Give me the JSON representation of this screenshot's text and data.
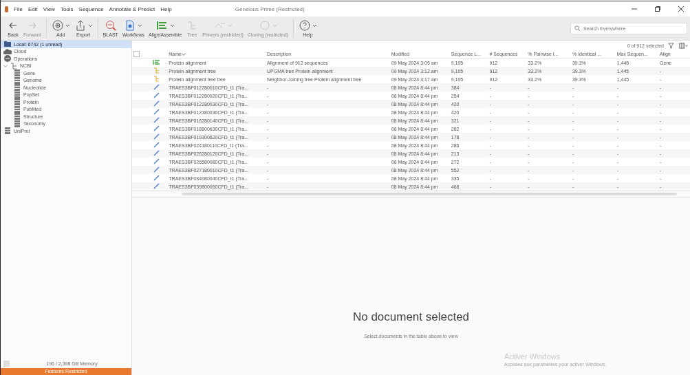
{
  "window": {
    "title": "Geneious Prime (Restricted)"
  },
  "menu": [
    "File",
    "Edit",
    "View",
    "Tools",
    "Sequence",
    "Annotate & Predict",
    "Help"
  ],
  "toolbar": [
    {
      "label": "Back",
      "disabled": false,
      "dropdown": false
    },
    {
      "label": "Forward",
      "disabled": true,
      "dropdown": false
    },
    {
      "label": "Add",
      "disabled": false,
      "dropdown": true
    },
    {
      "label": "Export",
      "disabled": false,
      "dropdown": true
    },
    {
      "label": "BLAST",
      "disabled": false,
      "dropdown": false
    },
    {
      "label": "Workflows",
      "disabled": false,
      "dropdown": true
    },
    {
      "label": "Align/Assemble",
      "disabled": false,
      "dropdown": true
    },
    {
      "label": "Tree",
      "disabled": true,
      "dropdown": false
    },
    {
      "label": "Primers (restricted)",
      "disabled": true,
      "dropdown": true
    },
    {
      "label": "Cloning (restricted)",
      "disabled": true,
      "dropdown": true
    },
    {
      "label": "Help",
      "disabled": false,
      "dropdown": true
    }
  ],
  "search": {
    "placeholder": "Search Everywhere"
  },
  "sidebar": {
    "items": [
      {
        "label": "Local: 6742 (1 unread)",
        "selected": true
      },
      {
        "label": "Cloud",
        "selected": false
      },
      {
        "label": "Operations",
        "selected": false
      },
      {
        "label": "NCBI",
        "selected": false,
        "expanded": true,
        "children": [
          {
            "label": "Gene",
            "selected": false
          },
          {
            "label": "Genome",
            "selected": false
          },
          {
            "label": "Nucleotide",
            "selected": false
          },
          {
            "label": "PopSet",
            "selected": false
          },
          {
            "label": "Protein",
            "selected": false
          },
          {
            "label": "PubMed",
            "selected": false
          },
          {
            "label": "Structure",
            "selected": false
          },
          {
            "label": "Taxonomy",
            "selected": false
          }
        ]
      },
      {
        "label": "UniProt",
        "selected": false
      }
    ],
    "memory": "196 / 2,398 GB Memory",
    "banner": "Features Restricted"
  },
  "table": {
    "selection": "0 of 912 selected",
    "all_checked": false,
    "columns": [
      "Name",
      "Description",
      "Modified",
      "Sequence L...",
      "# Sequences",
      "% Pairwise I...",
      "% Identical ...",
      "Max Sequen...",
      "Align"
    ],
    "rows": [
      {
        "kind": "alignment",
        "cells": [
          "Protein alignment",
          "Alignment of 912 sequences",
          "09 May 2024 3:05 am",
          "9,105",
          "912",
          "33.2%",
          "39.3%",
          "1,445",
          "Gene"
        ]
      },
      {
        "kind": "tree",
        "cells": [
          "Protein alignment tree",
          "UPGMA tree Protein alignment",
          "09 May 2024 3:12 am",
          "9,105",
          "912",
          "33.2%",
          "39.3%",
          "1,445",
          "-"
        ]
      },
      {
        "kind": "tree",
        "cells": [
          "Protein alignment tree tree",
          "Neighbor-Joining tree Protein alignment tree",
          "09 May 2024 3:17 am",
          "9,105",
          "912",
          "33.2%",
          "39.3%",
          "1,445",
          "-"
        ]
      },
      {
        "kind": "sequence",
        "cells": [
          "TRAES3BF012280010CFD_t1 (Tra...",
          "-",
          "08 May 2024 8:44 pm",
          "384",
          "-",
          "-",
          "-",
          "-",
          "-"
        ]
      },
      {
        "kind": "sequence",
        "cells": [
          "TRAES3BF012280020CFD_t1 (Tra...",
          "-",
          "08 May 2024 8:44 pm",
          "254",
          "-",
          "-",
          "-",
          "-",
          "-"
        ]
      },
      {
        "kind": "sequence",
        "cells": [
          "TRAES3BF012280030CFD_t1 (Tra...",
          "-",
          "08 May 2024 8:44 pm",
          "420",
          "-",
          "-",
          "-",
          "-",
          "-"
        ]
      },
      {
        "kind": "sequence",
        "cells": [
          "TRAES3BF012380030CFD_t1 (Tra...",
          "-",
          "08 May 2024 8:44 pm",
          "420",
          "-",
          "-",
          "-",
          "-",
          "-"
        ]
      },
      {
        "kind": "sequence",
        "cells": [
          "TRAES3BF016280140CFD_t1 (Tra...",
          "-",
          "08 May 2024 8:44 pm",
          "321",
          "-",
          "-",
          "-",
          "-",
          "-"
        ]
      },
      {
        "kind": "sequence",
        "cells": [
          "TRAES3BF018800630CFD_t1 (Tra...",
          "-",
          "08 May 2024 8:44 pm",
          "282",
          "-",
          "-",
          "-",
          "-",
          "-"
        ]
      },
      {
        "kind": "sequence",
        "cells": [
          "TRAES3BF019300620CFD_t1 (Tra...",
          "-",
          "08 May 2024 8:44 pm",
          "178",
          "-",
          "-",
          "-",
          "-",
          "-"
        ]
      },
      {
        "kind": "sequence",
        "cells": [
          "TRAES3BF024180110CFD_t1 (Tra...",
          "-",
          "08 May 2024 8:44 pm",
          "286",
          "-",
          "-",
          "-",
          "-",
          "-"
        ]
      },
      {
        "kind": "sequence",
        "cells": [
          "TRAES3BF026280120CFD_t1 (Tra...",
          "-",
          "08 May 2024 8:44 pm",
          "213",
          "-",
          "-",
          "-",
          "-",
          "-"
        ]
      },
      {
        "kind": "sequence",
        "cells": [
          "TRAES3BF026580080CFD_t1 (Tra...",
          "-",
          "08 May 2024 8:44 pm",
          "272",
          "-",
          "-",
          "-",
          "-",
          "-"
        ]
      },
      {
        "kind": "sequence",
        "cells": [
          "TRAES3BF027180010CFD_t1 (Tra...",
          "-",
          "08 May 2024 8:44 pm",
          "552",
          "-",
          "-",
          "-",
          "-",
          "-"
        ]
      },
      {
        "kind": "sequence",
        "cells": [
          "TRAES3BF034080040CFD_t1 (Tra...",
          "-",
          "08 May 2024 8:44 pm",
          "335",
          "-",
          "-",
          "-",
          "-",
          "-"
        ]
      },
      {
        "kind": "sequence",
        "cells": [
          "TRAES3BF039800050CFD_t1 (Tra...",
          "-",
          "08 May 2024 8:44 pm",
          "468",
          "-",
          "-",
          "-",
          "-",
          "-"
        ]
      }
    ]
  },
  "viewer": {
    "title": "No document selected",
    "hint": "Select documents in the table above to view"
  },
  "activation": {
    "title": "Activer Windows",
    "text": "Accédez aux paramètres pour activer Windows."
  }
}
